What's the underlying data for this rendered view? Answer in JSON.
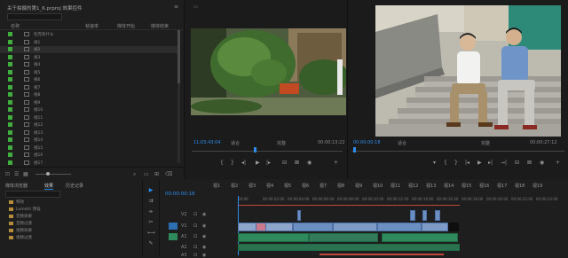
{
  "project": {
    "title": "关于拍摄的第1_6.prproj 效果控件",
    "columns": {
      "name": "名称",
      "rate": "帧速率",
      "start": "媒体开始",
      "end": "媒体结束"
    },
    "items": [
      {
        "name": "吃完有什么"
      },
      {
        "name": "视1"
      },
      {
        "name": "视2"
      },
      {
        "name": "视3"
      },
      {
        "name": "视4"
      },
      {
        "name": "视5"
      },
      {
        "name": "视6"
      },
      {
        "name": "视7"
      },
      {
        "name": "视8"
      },
      {
        "name": "视9"
      },
      {
        "name": "视10"
      },
      {
        "name": "视11"
      },
      {
        "name": "视12"
      },
      {
        "name": "视13"
      },
      {
        "name": "视14"
      },
      {
        "name": "视15"
      },
      {
        "name": "视16"
      },
      {
        "name": "视17"
      }
    ]
  },
  "source": {
    "timecode": "11:03:43:04",
    "fit": "适合",
    "quality": "完整",
    "duration": "00:00:13:22"
  },
  "program": {
    "timecode": "00:00:00:18",
    "fit": "适合",
    "quality": "完整",
    "duration": "00:00:27:12"
  },
  "bottom_panel": {
    "tabs": [
      "媒体浏览器",
      "效果",
      "历史记录"
    ],
    "bins": [
      "特效",
      "Lumetri 预设",
      "音频效果",
      "音频过渡",
      "视频效果",
      "视频过渡"
    ]
  },
  "timeline": {
    "timecode": "00:00:00:18",
    "tabs": [
      "视1",
      "视2",
      "视3",
      "视4",
      "视5",
      "视6",
      "视7",
      "视8",
      "视9",
      "视10",
      "视11",
      "视12",
      "视13",
      "视14",
      "视15",
      "视16",
      "视17",
      "视18",
      "视19"
    ],
    "tracks": [
      "V2",
      "V1",
      "A1",
      "A2",
      "A3"
    ],
    "ticks": [
      "00:00",
      "00:00:02:00",
      "00:00:04:00",
      "00:00:06:00",
      "00:00:08:00",
      "00:00:10:00",
      "00:00:12:00",
      "00:00:14:00",
      "00:00:16:00",
      "00:00:18:00",
      "00:00:20:00",
      "00:00:22:00",
      "00:00:24:00"
    ]
  },
  "colors": {
    "accent": "#2d8ceb",
    "label_green": "#3fae3f",
    "video_clip": "#6c8fc2",
    "audio_clip": "#2e8a5c"
  }
}
